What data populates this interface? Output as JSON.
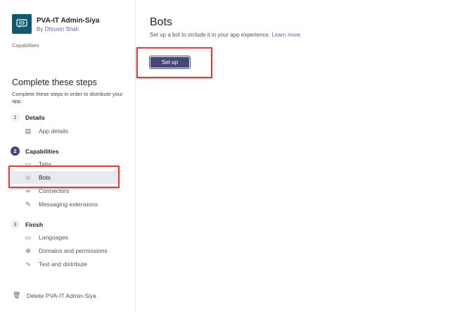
{
  "app": {
    "title": "PVA-IT Admin-Siya",
    "by": "By",
    "author": "Dhruvin Shah",
    "breadcrumb": "Capabilities"
  },
  "steps": {
    "heading": "Complete these steps",
    "description": "Complete these steps in order to distribute your app.",
    "groups": [
      {
        "num": "1",
        "label": "Details",
        "items": [
          {
            "label": "App details",
            "icon": "document-icon"
          }
        ]
      },
      {
        "num": "2",
        "label": "Capabilities",
        "items": [
          {
            "label": "Tabs",
            "icon": "tab-icon"
          },
          {
            "label": "Bots",
            "icon": "bot-icon"
          },
          {
            "label": "Connectors",
            "icon": "connector-icon"
          },
          {
            "label": "Messaging extensions",
            "icon": "edit-icon"
          }
        ]
      },
      {
        "num": "3",
        "label": "Finish",
        "items": [
          {
            "label": "Languages",
            "icon": "window-icon"
          },
          {
            "label": "Domains and permissions",
            "icon": "globe-icon"
          },
          {
            "label": "Test and distribute",
            "icon": "pulse-icon"
          }
        ]
      }
    ]
  },
  "delete_label": "Delete PVA-IT Admin-Siya",
  "main": {
    "title": "Bots",
    "subtitle": "Set up a bot to include it in your app experience.",
    "learn_more": "Learn more",
    "setup_button": "Set up"
  },
  "colors": {
    "accent": "#464775",
    "logo": "#0f5a6e",
    "highlight": "#e03c3c"
  }
}
